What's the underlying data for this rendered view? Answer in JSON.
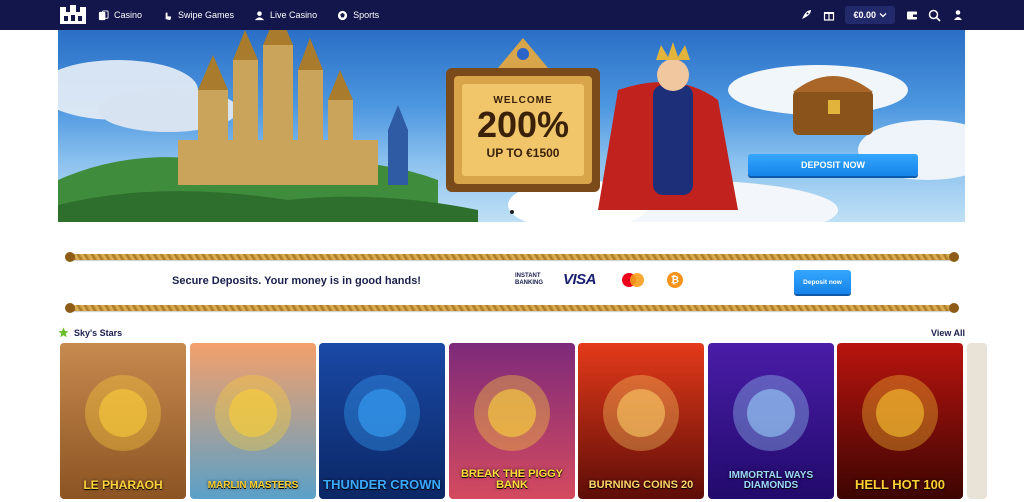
{
  "nav": {
    "items": [
      {
        "label": "Casino",
        "icon": "casino-icon"
      },
      {
        "label": "Swipe Games",
        "icon": "swipe-icon"
      },
      {
        "label": "Live Casino",
        "icon": "live-icon"
      },
      {
        "label": "Sports",
        "icon": "sports-icon"
      }
    ],
    "balance": "€0.00"
  },
  "hero": {
    "welcome_line": "WELCOME",
    "percent": "200%",
    "up_to": "UP TO €1500",
    "cta": "DEPOSIT NOW"
  },
  "deposits": {
    "message": "Secure Deposits. Your money is in good hands!",
    "instant_banking": "INSTANT BANKING",
    "visa": "VISA",
    "bitcoin_symbol": "₿",
    "button": "Deposit now"
  },
  "games_section": {
    "title": "Sky's Stars",
    "view_all": "View All",
    "games": [
      {
        "title": "LE PHARAOH",
        "bg_top": "#c78a4f",
        "bg_bottom": "#8c5423",
        "title_color": "#ffd33c"
      },
      {
        "title": "MARLIN MASTERS",
        "bg_top": "#f4a06b",
        "bg_bottom": "#5aa0c8",
        "title_color": "#ffd12f"
      },
      {
        "title": "THUNDER CROWN",
        "bg_top": "#1a49a6",
        "bg_bottom": "#0b2765",
        "title_color": "#3aa9ff"
      },
      {
        "title": "BREAK THE PIGGY BANK",
        "bg_top": "#7d2a7a",
        "bg_bottom": "#d44a5f",
        "title_color": "#ffde3a"
      },
      {
        "title": "BURNING COINS 20",
        "bg_top": "#e43a1a",
        "bg_bottom": "#5e0d07",
        "title_color": "#ffd66b"
      },
      {
        "title": "IMMORTAL WAYS DIAMONDS",
        "bg_top": "#4a1da8",
        "bg_bottom": "#210a6b",
        "title_color": "#9fd9ff"
      },
      {
        "title": "HELL HOT 100",
        "bg_top": "#b9140f",
        "bg_bottom": "#3d0502",
        "title_color": "#ffcf33"
      }
    ]
  }
}
